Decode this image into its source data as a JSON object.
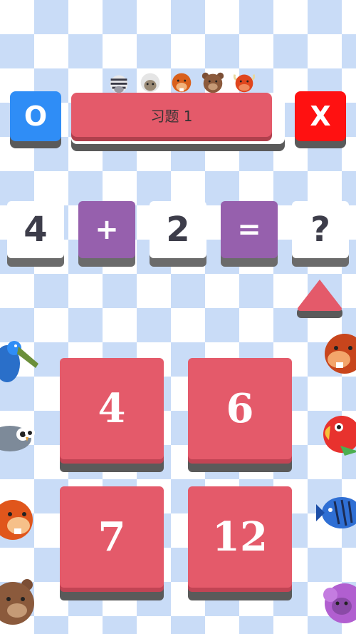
{
  "header": {
    "left_button": "O",
    "title": "习题 1",
    "right_button": "X",
    "animals": [
      "zebra-icon",
      "sheep-icon",
      "beaver-icon",
      "bear-icon",
      "bull-icon"
    ]
  },
  "equation": {
    "operand1": "4",
    "operator": "+",
    "operand2": "2",
    "equals": "=",
    "result": "?"
  },
  "answers": [
    "4",
    "6",
    "7",
    "12"
  ],
  "side_animals": {
    "left": [
      "pelican-icon",
      "owl-icon",
      "beaver-icon",
      "bear-icon"
    ],
    "right": [
      "beaver-icon",
      "parrot-icon",
      "fish-icon",
      "sheep-icon"
    ]
  },
  "colors": {
    "accent_red": "#e45a6a",
    "blue": "#2f8df6",
    "close_red": "#ff1111",
    "purple": "#9660ad"
  }
}
